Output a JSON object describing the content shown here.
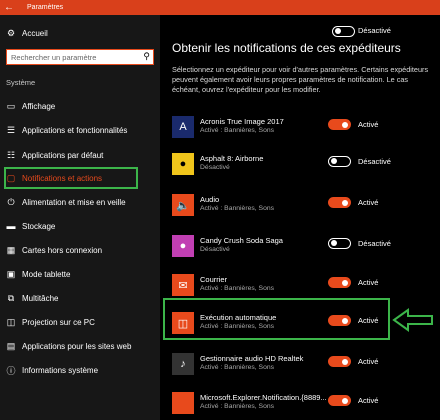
{
  "window": {
    "title": "Paramètres",
    "back_icon": "back-arrow-icon"
  },
  "sidebar": {
    "home": "Accueil",
    "search_placeholder": "Rechercher un paramètre",
    "section": "Système",
    "items": [
      {
        "label": "Affichage",
        "icon": "monitor-icon"
      },
      {
        "label": "Applications et fonctionnalités",
        "icon": "list-icon"
      },
      {
        "label": "Applications par défaut",
        "icon": "list-icon"
      },
      {
        "label": "Notifications et actions",
        "icon": "notification-icon",
        "active": true
      },
      {
        "label": "Alimentation et mise en veille",
        "icon": "power-icon"
      },
      {
        "label": "Stockage",
        "icon": "storage-icon"
      },
      {
        "label": "Cartes hors connexion",
        "icon": "map-icon"
      },
      {
        "label": "Mode tablette",
        "icon": "tablet-icon"
      },
      {
        "label": "Multitâche",
        "icon": "multitask-icon"
      },
      {
        "label": "Projection sur ce PC",
        "icon": "projection-icon"
      },
      {
        "label": "Applications pour les sites web",
        "icon": "web-icon"
      },
      {
        "label": "Informations système",
        "icon": "info-icon"
      }
    ]
  },
  "main": {
    "top_state": "Désactivé",
    "heading": "Obtenir les notifications de ces expéditeurs",
    "description": "Sélectionnez un expéditeur pour voir d'autres paramètres. Certains expéditeurs peuvent également avoir leurs propres paramètres de notification. Le cas échéant, ouvrez l'expéditeur pour les modifier.",
    "apps": [
      {
        "name": "Acronis True Image 2017",
        "sub": "Activé : Bannières, Sons",
        "state": "Activé",
        "on": true,
        "icon": "acronis-icon",
        "color": "#1a2a6c"
      },
      {
        "name": "Asphalt 8: Airborne",
        "sub": "Désactivé",
        "state": "Désactivé",
        "on": false,
        "icon": "asphalt-icon",
        "color": "#333333"
      },
      {
        "name": "Audio",
        "sub": "Activé : Bannières, Sons",
        "state": "Activé",
        "on": true,
        "icon": "speaker-icon",
        "color": "#e84a1c"
      },
      {
        "name": "Candy Crush Soda Saga",
        "sub": "Désactivé",
        "state": "Désactivé",
        "on": false,
        "icon": "candy-crush-icon",
        "color": "#c13fb3"
      },
      {
        "name": "Courrier",
        "sub": "Activé : Bannières, Sons",
        "state": "Activé",
        "on": true,
        "icon": "mail-icon",
        "color": "#e84a1c"
      },
      {
        "name": "Exécution automatique",
        "sub": "Activé : Bannières, Sons",
        "state": "Activé",
        "on": true,
        "icon": "autoplay-icon",
        "color": "#e84a1c"
      },
      {
        "name": "Gestionnaire audio HD Realtek",
        "sub": "Activé : Bannières, Sons",
        "state": "Activé",
        "on": true,
        "icon": "realtek-icon",
        "color": "#333333"
      },
      {
        "name": "Microsoft.Explorer.Notification.{8889...",
        "sub": "Activé : Bannières, Sons",
        "state": "Activé",
        "on": true,
        "icon": "explorer-icon",
        "color": "#e84a1c"
      }
    ]
  },
  "colors": {
    "accent": "#e84a1c",
    "highlight": "#3cb54a",
    "titlebar": "#d9401b"
  }
}
